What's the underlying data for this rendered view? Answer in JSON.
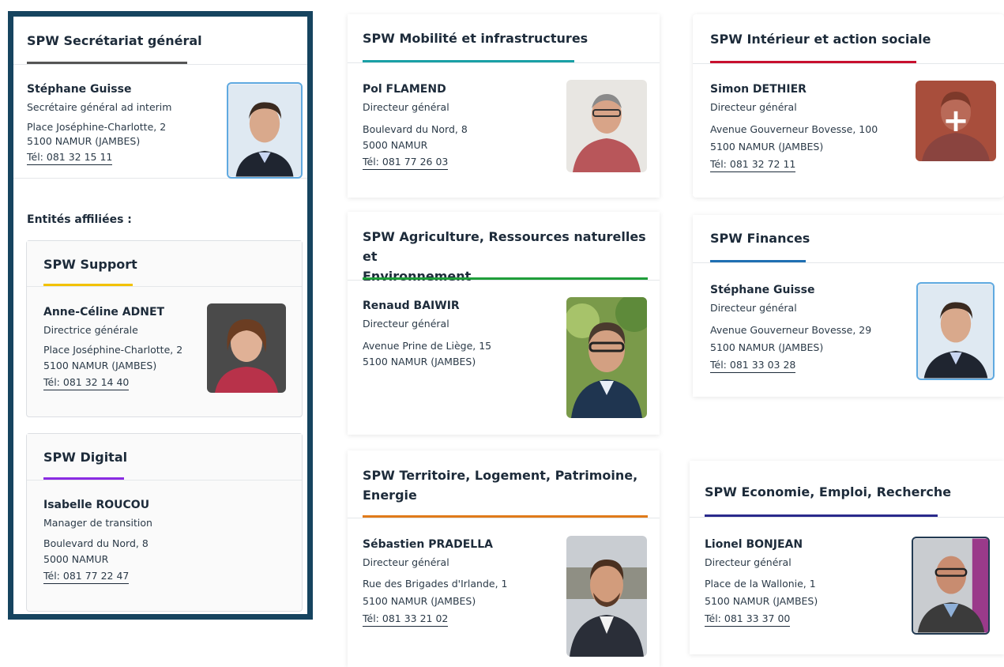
{
  "cards": {
    "sg": {
      "title": "SPW Secrétariat général",
      "accent": "#555555",
      "person": {
        "name": "Stéphane Guisse",
        "role": "Secrétaire général ad interim",
        "address_line1": "Place Joséphine-Charlotte, 2",
        "address_line2": "5100 NAMUR (JAMBES)",
        "tel": "Tél: 081 32 15 11"
      },
      "affiliated_label": "Entités affiliées :",
      "support": {
        "title": "SPW Support",
        "accent": "#f2c200",
        "person": {
          "name": "Anne-Céline ADNET",
          "role": "Directrice générale",
          "address_line1": "Place Joséphine-Charlotte, 2",
          "address_line2": "5100 NAMUR (JAMBES)",
          "tel": "Tél: 081 32 14 40"
        }
      },
      "digital": {
        "title": "SPW Digital",
        "accent": "#8a2be2",
        "person": {
          "name": "Isabelle ROUCOU",
          "role": "Manager de transition",
          "address_line1": "Boulevard du Nord, 8",
          "address_line2": "5000 NAMUR",
          "tel": "Tél: 081 77 22 47"
        }
      }
    },
    "mobilite": {
      "title": "SPW Mobilité et infrastructures",
      "accent": "#1aa0a6",
      "person": {
        "name": "Pol FLAMEND",
        "role": "Directeur général",
        "address_line1": "Boulevard du Nord, 8",
        "address_line2": "5000 NAMUR",
        "tel": "Tél: 081 77 26 03"
      }
    },
    "agriculture": {
      "title_line1": "SPW Agriculture, Ressources naturelles et",
      "title_line2": "Environnement",
      "accent": "#1f9e3a",
      "person": {
        "name": "Renaud BAIWIR",
        "role": "Directeur général",
        "address_line1": "Avenue Prine de Liège, 15",
        "address_line2": "5100 NAMUR (JAMBES)"
      }
    },
    "territoire": {
      "title_line1": "SPW Territoire, Logement, Patrimoine,",
      "title_line2": "Energie",
      "accent": "#e07b1a",
      "person": {
        "name": "Sébastien PRADELLA",
        "role": "Directeur général",
        "address_line1": "Rue des Brigades d'Irlande, 1",
        "address_line2": "5100 NAMUR (JAMBES)",
        "tel": "Tél: 081 33 21 02"
      }
    },
    "interieur": {
      "title": "SPW Intérieur et action sociale",
      "accent": "#c8102e",
      "person": {
        "name": "Simon DETHIER",
        "role": "Directeur général",
        "address_line1": "Avenue Gouverneur Bovesse, 100",
        "address_line2": "5100 NAMUR (JAMBES)",
        "tel": "Tél: 081 32 72 11"
      }
    },
    "finances": {
      "title": "SPW Finances",
      "accent": "#1f6fb2",
      "person": {
        "name": "Stéphane Guisse",
        "role": "Directeur général",
        "address_line1": "Avenue Gouverneur Bovesse, 29",
        "address_line2": "5100 NAMUR (JAMBES)",
        "tel": "Tél: 081 33 03 28"
      }
    },
    "economie": {
      "title": "SPW Economie, Emploi, Recherche",
      "accent": "#2a2a8c",
      "person": {
        "name": "Lionel BONJEAN",
        "role": "Directeur général",
        "address_line1": "Place de la Wallonie, 1",
        "address_line2": "5100 NAMUR (JAMBES)",
        "tel": "Tél: 081 33 37 00"
      }
    }
  },
  "icons": {
    "portrait": "person-photo",
    "hover_overlay": "plus-icon"
  }
}
